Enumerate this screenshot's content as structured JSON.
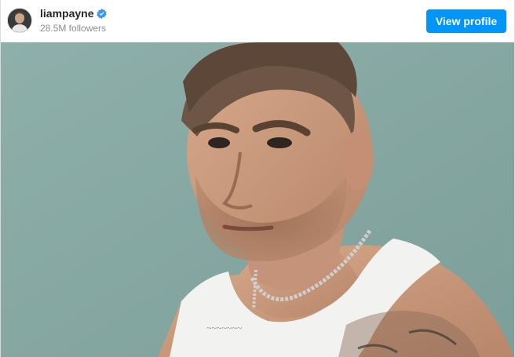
{
  "post": {
    "username": "liampayne",
    "verified": true,
    "followers": "28.5M followers",
    "view_profile_label": "View profile"
  },
  "icons": {
    "verified": "verified-badge-icon",
    "avatar": "profile-avatar"
  },
  "colors": {
    "button": "#0095f6",
    "verified_badge": "#3897f0",
    "background_teal": "#86a8a3"
  }
}
